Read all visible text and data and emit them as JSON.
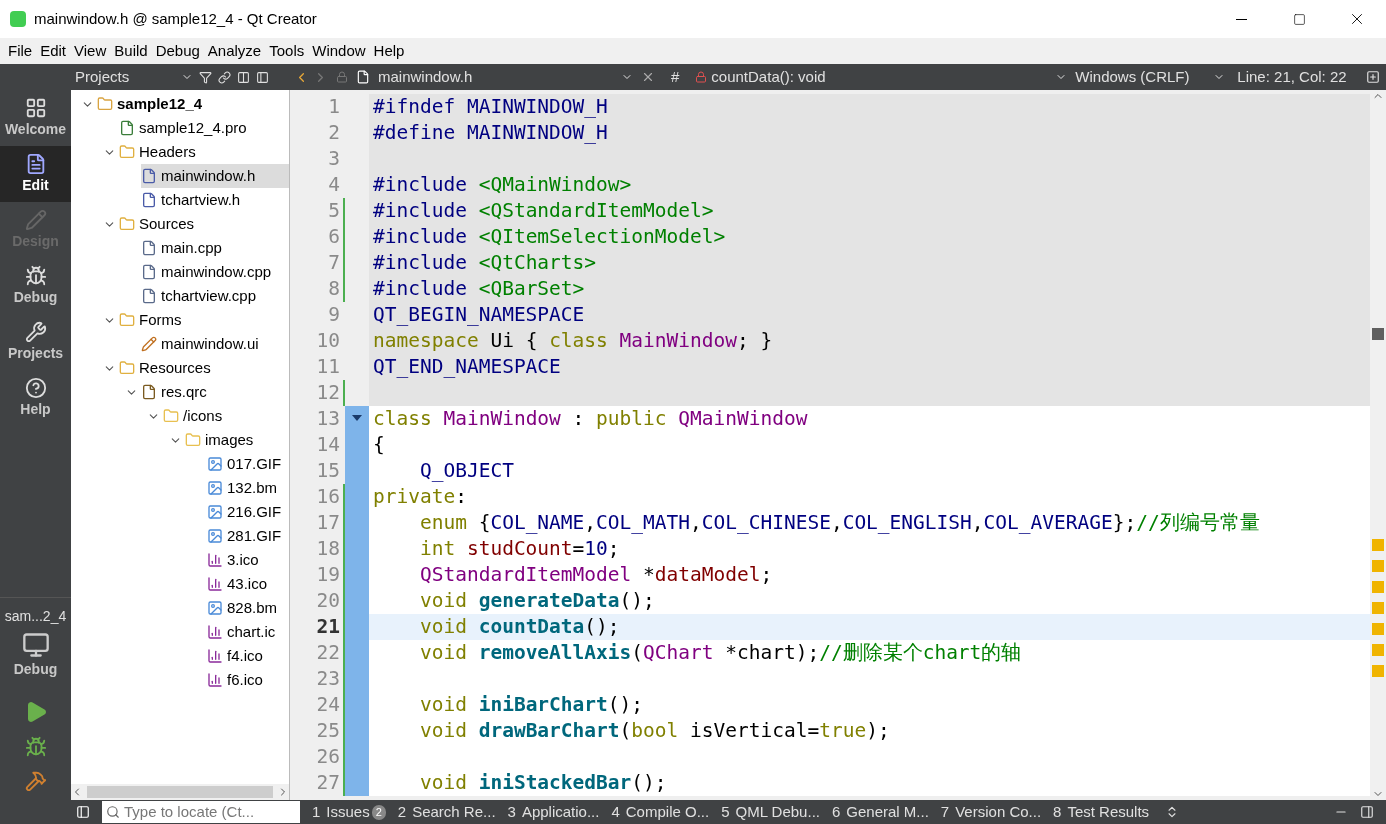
{
  "window": {
    "title": "mainwindow.h @ sample12_4 - Qt Creator"
  },
  "menu": [
    "File",
    "Edit",
    "View",
    "Build",
    "Debug",
    "Analyze",
    "Tools",
    "Window",
    "Help"
  ],
  "modes": [
    {
      "label": "Welcome",
      "kind": "grid",
      "selected": false,
      "disabled": false
    },
    {
      "label": "Edit",
      "kind": "doc",
      "selected": true,
      "disabled": false
    },
    {
      "label": "Design",
      "kind": "pencil",
      "selected": false,
      "disabled": true
    },
    {
      "label": "Debug",
      "kind": "bug",
      "selected": false,
      "disabled": false
    },
    {
      "label": "Projects",
      "kind": "wrench",
      "selected": false,
      "disabled": false
    },
    {
      "label": "Help",
      "kind": "help",
      "selected": false,
      "disabled": false
    }
  ],
  "kit": {
    "project": "sam...2_4",
    "label": "Debug"
  },
  "projects_pane": {
    "title": "Projects",
    "tree": [
      {
        "label": "sample12_4",
        "kind": "project",
        "selected": false,
        "expanded": true,
        "children": [
          {
            "label": "sample12_4.pro",
            "kind": "pro",
            "selected": false
          },
          {
            "label": "Headers",
            "kind": "headers",
            "selected": false,
            "expanded": true,
            "children": [
              {
                "label": "mainwindow.h",
                "kind": "header",
                "selected": true
              },
              {
                "label": "tchartview.h",
                "kind": "header",
                "selected": false
              }
            ]
          },
          {
            "label": "Sources",
            "kind": "sources",
            "selected": false,
            "expanded": true,
            "children": [
              {
                "label": "main.cpp",
                "kind": "source",
                "selected": false
              },
              {
                "label": "mainwindow.cpp",
                "kind": "source",
                "selected": false
              },
              {
                "label": "tchartview.cpp",
                "kind": "source",
                "selected": false
              }
            ]
          },
          {
            "label": "Forms",
            "kind": "forms",
            "selected": false,
            "expanded": true,
            "children": [
              {
                "label": "mainwindow.ui",
                "kind": "form",
                "selected": false
              }
            ]
          },
          {
            "label": "Resources",
            "kind": "resources",
            "selected": false,
            "expanded": true,
            "children": [
              {
                "label": "res.qrc",
                "kind": "qrc",
                "selected": false,
                "expanded": true,
                "children": [
                  {
                    "label": "/icons",
                    "kind": "folder",
                    "selected": false,
                    "expanded": true,
                    "children": [
                      {
                        "label": "images",
                        "kind": "folder",
                        "selected": false,
                        "expanded": true,
                        "children": [
                          {
                            "label": "017.GIF",
                            "kind": "image",
                            "selected": false
                          },
                          {
                            "label": "132.bm",
                            "kind": "image",
                            "selected": false
                          },
                          {
                            "label": "216.GIF",
                            "kind": "image",
                            "selected": false
                          },
                          {
                            "label": "281.GIF",
                            "kind": "image",
                            "selected": false
                          },
                          {
                            "label": "3.ico",
                            "kind": "ico",
                            "selected": false
                          },
                          {
                            "label": "43.ico",
                            "kind": "ico",
                            "selected": false
                          },
                          {
                            "label": "828.bm",
                            "kind": "image",
                            "selected": false
                          },
                          {
                            "label": "chart.ic",
                            "kind": "ico",
                            "selected": false
                          },
                          {
                            "label": "f4.ico",
                            "kind": "ico",
                            "selected": false
                          },
                          {
                            "label": "f6.ico",
                            "kind": "ico",
                            "selected": false
                          }
                        ]
                      }
                    ]
                  }
                ]
              }
            ]
          }
        ]
      }
    ]
  },
  "editor_toolbar": {
    "file": "mainwindow.h",
    "hash": "#",
    "symbol": "countData(): void",
    "line_ending": "Windows (CRLF)",
    "position": "Line: 21, Col: 22"
  },
  "code": [
    {
      "number": "1",
      "shaded": true,
      "current": false,
      "modified": false,
      "tokens": [
        {
          "kind": "pre",
          "text": "#ifndef MAINWINDOW_H"
        }
      ]
    },
    {
      "number": "2",
      "shaded": true,
      "current": false,
      "modified": false,
      "tokens": [
        {
          "kind": "pre",
          "text": "#define MAINWINDOW_H"
        }
      ]
    },
    {
      "number": "3",
      "shaded": true,
      "current": false,
      "modified": false
    },
    {
      "number": "4",
      "shaded": true,
      "current": false,
      "modified": false,
      "tokens": [
        {
          "kind": "pre",
          "text": "#include "
        },
        {
          "kind": "inc",
          "text": "<QMainWindow>"
        }
      ]
    },
    {
      "number": "5",
      "shaded": true,
      "current": false,
      "modified": true,
      "tokens": [
        {
          "kind": "pre",
          "text": "#include "
        },
        {
          "kind": "inc",
          "text": "<QStandardItemModel>"
        }
      ]
    },
    {
      "number": "6",
      "shaded": true,
      "current": false,
      "modified": true,
      "tokens": [
        {
          "kind": "pre",
          "text": "#include "
        },
        {
          "kind": "inc",
          "text": "<QItemSelectionModel>"
        }
      ]
    },
    {
      "number": "7",
      "shaded": true,
      "current": false,
      "modified": true,
      "tokens": [
        {
          "kind": "pre",
          "text": "#include "
        },
        {
          "kind": "inc",
          "text": "<QtCharts>"
        }
      ]
    },
    {
      "number": "8",
      "shaded": true,
      "current": false,
      "modified": true,
      "tokens": [
        {
          "kind": "pre",
          "text": "#include "
        },
        {
          "kind": "inc",
          "text": "<QBarSet>"
        }
      ]
    },
    {
      "number": "9",
      "shaded": true,
      "current": false,
      "modified": false,
      "tokens": [
        {
          "kind": "pre",
          "text": "QT_BEGIN_NAMESPACE"
        }
      ]
    },
    {
      "number": "10",
      "shaded": true,
      "current": false,
      "modified": false,
      "tokens": [
        {
          "kind": "kw",
          "text": "namespace"
        },
        {
          "kind": "plain",
          "text": " Ui { "
        },
        {
          "kind": "kw",
          "text": "class "
        },
        {
          "kind": "type",
          "text": "MainWindow"
        },
        {
          "kind": "plain",
          "text": "; }"
        }
      ]
    },
    {
      "number": "11",
      "shaded": true,
      "current": false,
      "modified": false,
      "tokens": [
        {
          "kind": "pre",
          "text": "QT_END_NAMESPACE"
        }
      ]
    },
    {
      "number": "12",
      "shaded": true,
      "current": false,
      "modified": true
    },
    {
      "number": "13",
      "shaded": false,
      "current": false,
      "modified": false,
      "tokens": [
        {
          "kind": "kw",
          "text": "class "
        },
        {
          "kind": "type",
          "text": "MainWindow"
        },
        {
          "kind": "plain",
          "text": " : "
        },
        {
          "kind": "kw",
          "text": "public "
        },
        {
          "kind": "type",
          "text": "QMainWindow"
        }
      ]
    },
    {
      "number": "14",
      "shaded": false,
      "current": false,
      "modified": false,
      "tokens": [
        {
          "kind": "plain",
          "text": "{"
        }
      ]
    },
    {
      "number": "15",
      "shaded": false,
      "current": false,
      "modified": false,
      "tokens": [
        {
          "kind": "pre",
          "text": "    Q_OBJECT"
        }
      ]
    },
    {
      "number": "16",
      "shaded": false,
      "current": false,
      "modified": true,
      "tokens": [
        {
          "kind": "kw",
          "text": "private"
        },
        {
          "kind": "plain",
          "text": ":"
        }
      ]
    },
    {
      "number": "17",
      "shaded": false,
      "current": false,
      "modified": true,
      "tokens": [
        {
          "kind": "kw",
          "text": "    enum"
        },
        {
          "kind": "plain",
          "text": " {"
        },
        {
          "kind": "enum",
          "text": "COL_NAME"
        },
        {
          "kind": "plain",
          "text": ","
        },
        {
          "kind": "enum",
          "text": "COL_MATH"
        },
        {
          "kind": "plain",
          "text": ","
        },
        {
          "kind": "enum",
          "text": "COL_CHINESE"
        },
        {
          "kind": "plain",
          "text": ","
        },
        {
          "kind": "enum",
          "text": "COL_ENGLISH"
        },
        {
          "kind": "plain",
          "text": ","
        },
        {
          "kind": "enum",
          "text": "COL_AVERAGE"
        },
        {
          "kind": "plain",
          "text": "};"
        },
        {
          "kind": "cm",
          "text": "//列编号常量"
        }
      ]
    },
    {
      "number": "18",
      "shaded": false,
      "current": false,
      "modified": true,
      "tokens": [
        {
          "kind": "kw",
          "text": "    int "
        },
        {
          "kind": "mem",
          "text": "studCount"
        },
        {
          "kind": "plain",
          "text": "="
        },
        {
          "kind": "num",
          "text": "10"
        },
        {
          "kind": "plain",
          "text": ";"
        }
      ]
    },
    {
      "number": "19",
      "shaded": false,
      "current": false,
      "modified": true,
      "tokens": [
        {
          "kind": "type",
          "text": "    QStandardItemModel"
        },
        {
          "kind": "plain",
          "text": " *"
        },
        {
          "kind": "mem",
          "text": "dataModel"
        },
        {
          "kind": "plain",
          "text": ";"
        }
      ]
    },
    {
      "number": "20",
      "shaded": false,
      "current": false,
      "modified": true,
      "tokens": [
        {
          "kind": "kw",
          "text": "    void "
        },
        {
          "kind": "fn",
          "text": "generateData"
        },
        {
          "kind": "plain",
          "text": "();"
        }
      ]
    },
    {
      "number": "21",
      "shaded": false,
      "current": true,
      "modified": true,
      "tokens": [
        {
          "kind": "kw",
          "text": "    void "
        },
        {
          "kind": "fn",
          "text": "countData"
        },
        {
          "kind": "plain",
          "text": "();"
        }
      ]
    },
    {
      "number": "22",
      "shaded": false,
      "current": false,
      "modified": true,
      "tokens": [
        {
          "kind": "kw",
          "text": "    void "
        },
        {
          "kind": "fn",
          "text": "removeAllAxis"
        },
        {
          "kind": "plain",
          "text": "("
        },
        {
          "kind": "type",
          "text": "QChart"
        },
        {
          "kind": "plain",
          "text": " *chart);"
        },
        {
          "kind": "cm",
          "text": "//删除某个chart的轴"
        }
      ]
    },
    {
      "number": "23",
      "shaded": false,
      "current": false,
      "modified": true
    },
    {
      "number": "24",
      "shaded": false,
      "current": false,
      "modified": true,
      "tokens": [
        {
          "kind": "kw",
          "text": "    void "
        },
        {
          "kind": "fn",
          "text": "iniBarChart"
        },
        {
          "kind": "plain",
          "text": "();"
        }
      ]
    },
    {
      "number": "25",
      "shaded": false,
      "current": false,
      "modified": true,
      "tokens": [
        {
          "kind": "kw",
          "text": "    void "
        },
        {
          "kind": "fn",
          "text": "drawBarChart"
        },
        {
          "kind": "plain",
          "text": "("
        },
        {
          "kind": "kw",
          "text": "bool"
        },
        {
          "kind": "plain",
          "text": " isVertical="
        },
        {
          "kind": "kw",
          "text": "true"
        },
        {
          "kind": "plain",
          "text": ");"
        }
      ]
    },
    {
      "number": "26",
      "shaded": false,
      "current": false,
      "modified": true
    },
    {
      "number": "27",
      "shaded": false,
      "current": false,
      "modified": true,
      "tokens": [
        {
          "kind": "kw",
          "text": "    void "
        },
        {
          "kind": "fn",
          "text": "iniStackedBar"
        },
        {
          "kind": "plain",
          "text": "();"
        }
      ]
    }
  ],
  "status_bar": {
    "locator": {
      "placeholder": "Type to locate (Ct..."
    },
    "panes": [
      {
        "number": "1",
        "label": "Issues",
        "badge": "2"
      },
      {
        "number": "2",
        "label": "Search Re..."
      },
      {
        "number": "3",
        "label": "Applicatio..."
      },
      {
        "number": "4",
        "label": "Compile O..."
      },
      {
        "number": "5",
        "label": "QML Debu..."
      },
      {
        "number": "6",
        "label": "General M..."
      },
      {
        "number": "7",
        "label": "Version Co..."
      },
      {
        "number": "8",
        "label": "Test Results"
      }
    ]
  }
}
